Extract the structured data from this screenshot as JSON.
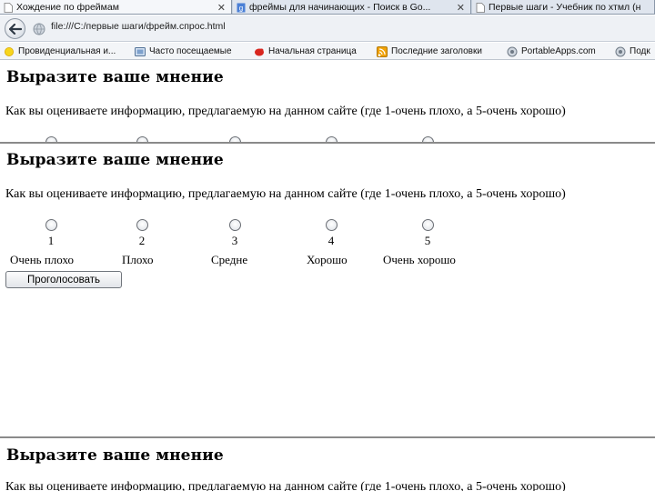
{
  "browser": {
    "tabs": [
      {
        "title": "Хождение по фреймам",
        "active": true
      },
      {
        "title": "фреймы для начинающих - Поиск в Go...",
        "active": false
      },
      {
        "title": "Первые шаги - Учебник по хтмл (н",
        "active": false
      }
    ],
    "url": "file:///C:/первые шаги/фрейм.спрос.html",
    "bookmarks": [
      {
        "label": "Провиденциальная и...",
        "icon": "sun-icon"
      },
      {
        "label": "Часто посещаемые",
        "icon": "folder-icon"
      },
      {
        "label": "Начальная страница",
        "icon": "red-bird-icon"
      },
      {
        "label": "Последние заголовки",
        "icon": "rss-icon"
      },
      {
        "label": "PortableApps.com",
        "icon": "globe-icon"
      },
      {
        "label": "Подк",
        "icon": "globe-icon"
      }
    ]
  },
  "page": {
    "heading": "Выразите ваше мнение",
    "question": "Как вы оцениваете информацию, предлагаемую на данном сайте (где 1-очень плохо, а 5-очень хорошо)",
    "rating_numbers": [
      "1",
      "2",
      "3",
      "4",
      "5"
    ],
    "rating_captions": [
      "Очень плохо",
      "Плохо",
      "Средне",
      "Хорошо",
      "Очень хорошо"
    ],
    "vote_button": "Проголосовать"
  },
  "colors": {
    "tab_bar": "#c9d3e0",
    "nav_bar": "#eef1f5",
    "divider": "#8a8a8a"
  }
}
